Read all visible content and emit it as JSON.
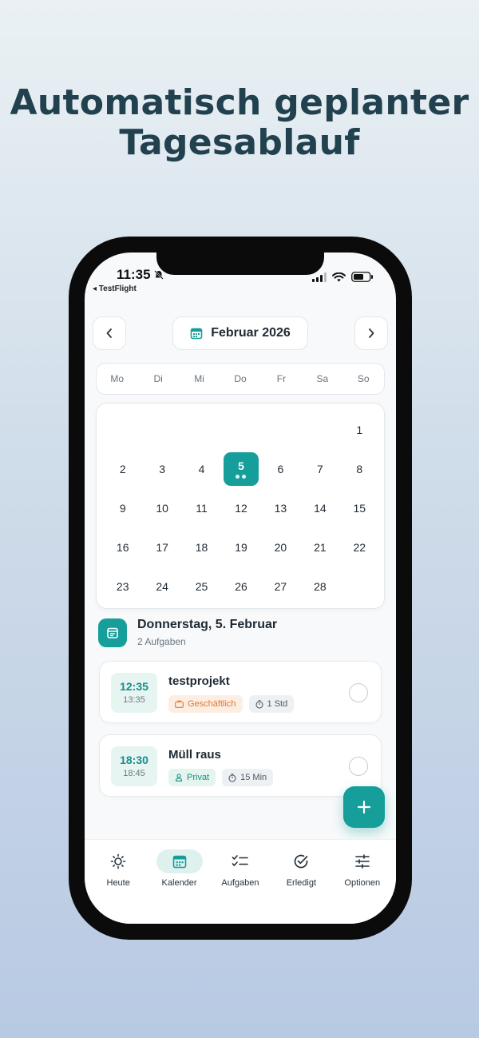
{
  "headline": {
    "line1": "Automatisch geplanter",
    "line2": "Tagesablauf"
  },
  "status_bar": {
    "time": "11:35",
    "back_label": "◂ TestFlight"
  },
  "calendar_header": {
    "month": "Februar 2026"
  },
  "weekdays": [
    "Mo",
    "Di",
    "Mi",
    "Do",
    "Fr",
    "Sa",
    "So"
  ],
  "calendar": {
    "days": [
      "",
      "",
      "",
      "",
      "",
      "",
      "1",
      "2",
      "3",
      "4",
      "5",
      "6",
      "7",
      "8",
      "9",
      "10",
      "11",
      "12",
      "13",
      "14",
      "15",
      "16",
      "17",
      "18",
      "19",
      "20",
      "21",
      "22",
      "23",
      "24",
      "25",
      "26",
      "27",
      "28",
      ""
    ],
    "selected_day": "5"
  },
  "day_header": {
    "title": "Donnerstag, 5. Februar",
    "subtitle": "2 Aufgaben"
  },
  "tasks": [
    {
      "start": "12:35",
      "end": "13:35",
      "title": "testprojekt",
      "category": "Geschäftlich",
      "duration": "1 Std"
    },
    {
      "start": "18:30",
      "end": "18:45",
      "title": "Müll raus",
      "category": "Privat",
      "duration": "15 Min"
    }
  ],
  "tabbar": {
    "today": "Heute",
    "calendar": "Kalender",
    "tasks": "Aufgaben",
    "done": "Erledigt",
    "options": "Optionen"
  },
  "colors": {
    "accent": "#169e9b",
    "business": "#e0782e",
    "private": "#1a8f80"
  }
}
